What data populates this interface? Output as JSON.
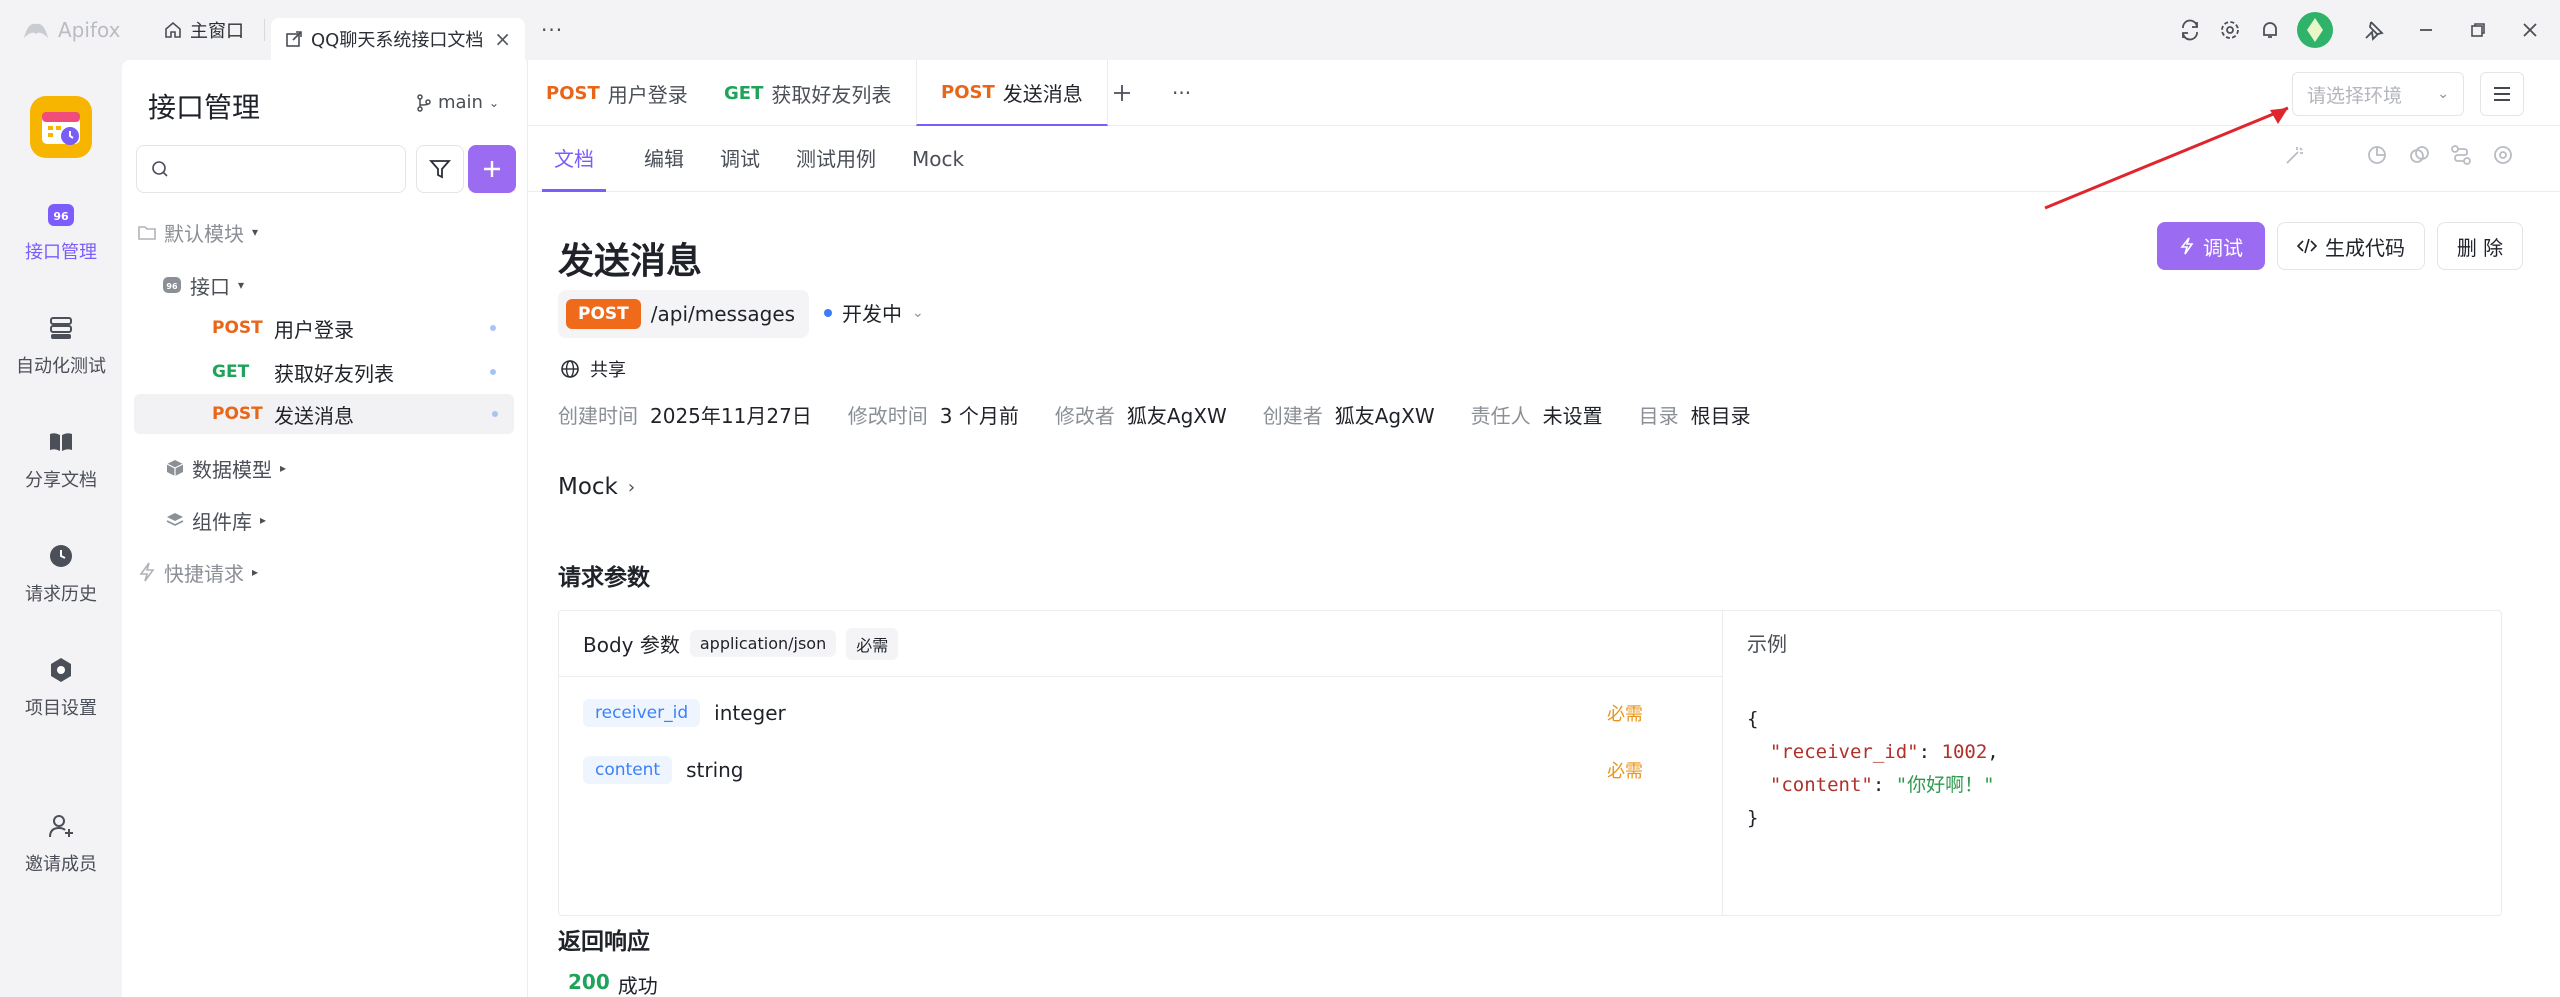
{
  "titlebar": {
    "brand": "Apifox",
    "home_tab": "主窗口",
    "active_tab": "QQ聊天系统接口文档",
    "more": "···"
  },
  "rail": {
    "items": [
      {
        "label": "接口管理",
        "icon": "api-management-icon",
        "active": true
      },
      {
        "label": "自动化测试",
        "icon": "automation-test-icon",
        "active": false
      },
      {
        "label": "分享文档",
        "icon": "share-docs-icon",
        "active": false
      },
      {
        "label": "请求历史",
        "icon": "history-icon",
        "active": false
      },
      {
        "label": "项目设置",
        "icon": "project-settings-icon",
        "active": false
      },
      {
        "label": "邀请成员",
        "icon": "invite-member-icon",
        "active": false
      }
    ]
  },
  "sidebar": {
    "title": "接口管理",
    "branch": "main",
    "search_placeholder": "",
    "tree": {
      "default_module": "默认模块",
      "interfaces": "接口",
      "items": [
        {
          "method": "POST",
          "name": "用户登录"
        },
        {
          "method": "GET",
          "name": "获取好友列表"
        },
        {
          "method": "POST",
          "name": "发送消息"
        }
      ],
      "data_models": "数据模型",
      "components": "组件库",
      "quick_request": "快捷请求"
    }
  },
  "tabs": [
    {
      "method": "POST",
      "name": "用户登录"
    },
    {
      "method": "GET",
      "name": "获取好友列表"
    },
    {
      "method": "POST",
      "name": "发送消息"
    }
  ],
  "env_placeholder": "请选择环境",
  "subtabs": [
    "文档",
    "编辑",
    "调试",
    "测试用例",
    "Mock"
  ],
  "doc": {
    "title": "发送消息",
    "method": "POST",
    "path": "/api/messages",
    "status": "开发中",
    "share": "共享",
    "buttons": {
      "debug": "调试",
      "gen_code": "生成代码",
      "delete": "删 除"
    },
    "meta": [
      {
        "k": "创建时间",
        "v": "2025年11月27日"
      },
      {
        "k": "修改时间",
        "v": "3 个月前"
      },
      {
        "k": "修改者",
        "v": "狐友AgXW"
      },
      {
        "k": "创建者",
        "v": "狐友AgXW"
      },
      {
        "k": "责任人",
        "v": "未设置"
      },
      {
        "k": "目录",
        "v": "根目录"
      }
    ],
    "mock": "Mock",
    "request_params": "请求参数",
    "body_label": "Body 参数",
    "content_type": "application/json",
    "required_chip": "必需",
    "params": [
      {
        "name": "receiver_id",
        "type": "integer",
        "req": "必需"
      },
      {
        "name": "content",
        "type": "string",
        "req": "必需"
      }
    ],
    "example_label": "示例",
    "example": {
      "open": "{",
      "k1": "\"receiver_id\"",
      "v1": "1002",
      "k2": "\"content\"",
      "v2": "\"你好啊！\"",
      "close": "}"
    },
    "response": "返回响应",
    "resp_code": "200",
    "resp_text": "成功"
  }
}
